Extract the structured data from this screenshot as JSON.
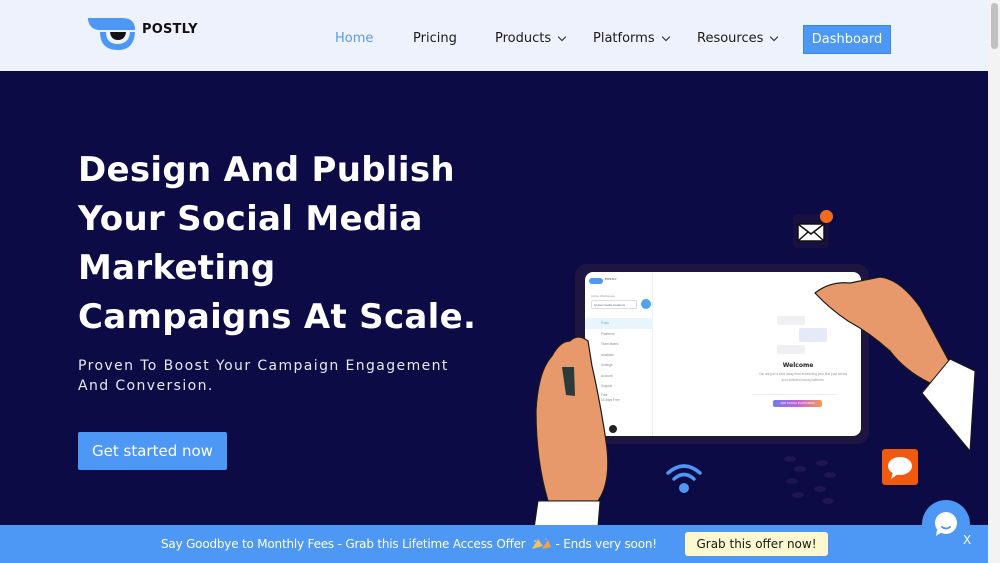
{
  "header": {
    "brand": "POSTLY",
    "nav": [
      {
        "label": "Home",
        "active": true,
        "has_dropdown": false
      },
      {
        "label": "Pricing",
        "active": false,
        "has_dropdown": false
      },
      {
        "label": "Products",
        "active": false,
        "has_dropdown": true
      },
      {
        "label": "Platforms",
        "active": false,
        "has_dropdown": true
      },
      {
        "label": "Resources",
        "active": false,
        "has_dropdown": true
      }
    ],
    "dashboard_label": "Dashboard"
  },
  "hero": {
    "title_lines": [
      "Design And Publish",
      "Your Social Media",
      "Marketing",
      "Campaigns At Scale."
    ],
    "subtitle_lines": [
      "Proven To Boost Your Campaign Engagement",
      "And Conversion."
    ],
    "cta_label": "Get started now"
  },
  "mockup": {
    "brand": "POSTLY",
    "workspace_label": "Active Workspace",
    "workspace_value": "tyrasonmedia creations",
    "menu": [
      "Posts",
      "Platforms",
      "Team Mates",
      "Analytics",
      "Settings",
      "Account",
      "Support"
    ],
    "plan_label": "Free",
    "plan_sub": "14 days Free",
    "welcome_title": "Welcome",
    "welcome_text": "You are just a click away from scheduling your first post across your selected social platforms.",
    "add_button": "ADD SOCIAL PLATFORMS"
  },
  "promo": {
    "text_before": "Say Goodbye to Monthly Fees - Grab this Lifetime Access Offer",
    "text_after": "- Ends very soon!",
    "button_label": "Grab this offer now!",
    "close_label": "X"
  },
  "colors": {
    "accent": "#4d97f5",
    "hero_bg": "#0c0b45",
    "header_bg": "#eef2fd",
    "nav_active": "#5a9bea",
    "offer_button_bg": "#fdf8d0",
    "notification": "#f26a1b"
  }
}
